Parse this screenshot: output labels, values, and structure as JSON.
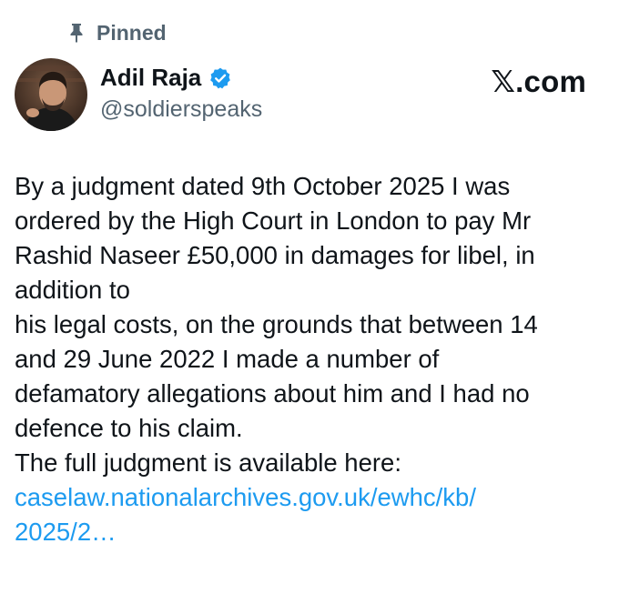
{
  "pinned": {
    "label": "Pinned",
    "icon": "pin-icon"
  },
  "author": {
    "name": "Adil Raja",
    "handle": "@soldierspeaks",
    "verified_icon": "verified-badge-icon",
    "verified_color": "#1d9bf0"
  },
  "brand": {
    "label": "𝕏.com"
  },
  "post": {
    "text": "By a judgment dated 9th October 2025 I was\nordered by the High Court in London to pay Mr\nRashid Naseer £50,000 in damages for libel, in\naddition to\nhis legal costs, on the grounds that between 14\nand 29 June 2022 I made a number of\ndefamatory allegations about him and I had no\ndefence to his claim.\nThe full judgment is available here:\n",
    "link": "caselaw.nationalarchives.gov.uk/ewhc/kb/\n2025/2…",
    "link_color": "#1d9bf0"
  }
}
